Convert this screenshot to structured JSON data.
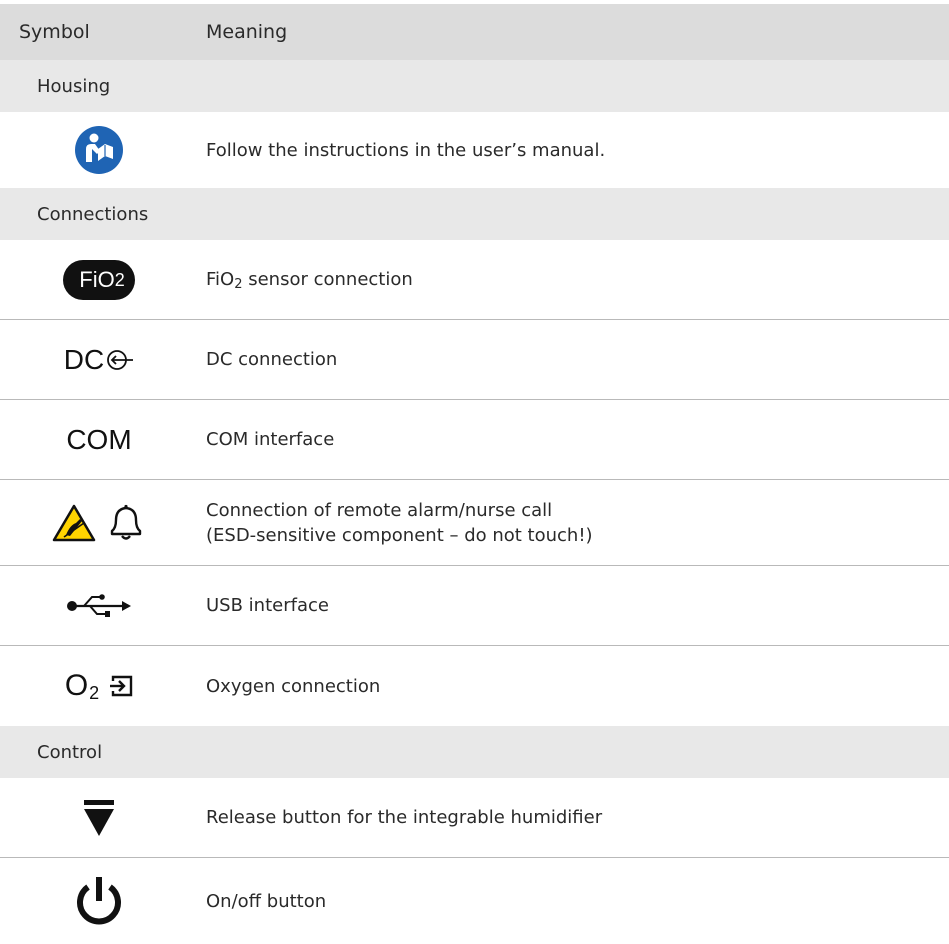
{
  "header": {
    "symbol": "Symbol",
    "meaning": "Meaning"
  },
  "sections": [
    {
      "label": "Housing",
      "items": [
        {
          "icon": "manual-icon",
          "meaning": "Follow the instructions in the user’s manual."
        }
      ]
    },
    {
      "label": "Connections",
      "items": [
        {
          "icon": "fio2-icon",
          "symbol_text": "FiO",
          "symbol_sub": "2",
          "meaning_prefix": "FiO",
          "meaning_sub": "2",
          "meaning_suffix": " sensor connection"
        },
        {
          "icon": "dc-icon",
          "symbol_text": "DC",
          "meaning": "DC connection"
        },
        {
          "icon": "com-icon",
          "symbol_text": "COM",
          "meaning": "COM interface"
        },
        {
          "icon": "esd-bell-icon",
          "meaning_line1": "Connection of remote alarm/nurse call",
          "meaning_line2": "(ESD-sensitive component – do not touch!)"
        },
        {
          "icon": "usb-icon",
          "meaning": "USB interface"
        },
        {
          "icon": "oxygen-icon",
          "symbol_text": "O",
          "symbol_sub": "2",
          "meaning": "Oxygen connection"
        }
      ]
    },
    {
      "label": "Control",
      "items": [
        {
          "icon": "release-arrow-icon",
          "meaning": "Release button for the integrable humidifier"
        },
        {
          "icon": "power-icon",
          "meaning": "On/off button"
        }
      ]
    }
  ],
  "colors": {
    "manual_blue": "#1f64b4",
    "esd_yellow": "#ffd400",
    "header_bg": "#dcdcdc",
    "section_bg": "#e8e8e8"
  }
}
